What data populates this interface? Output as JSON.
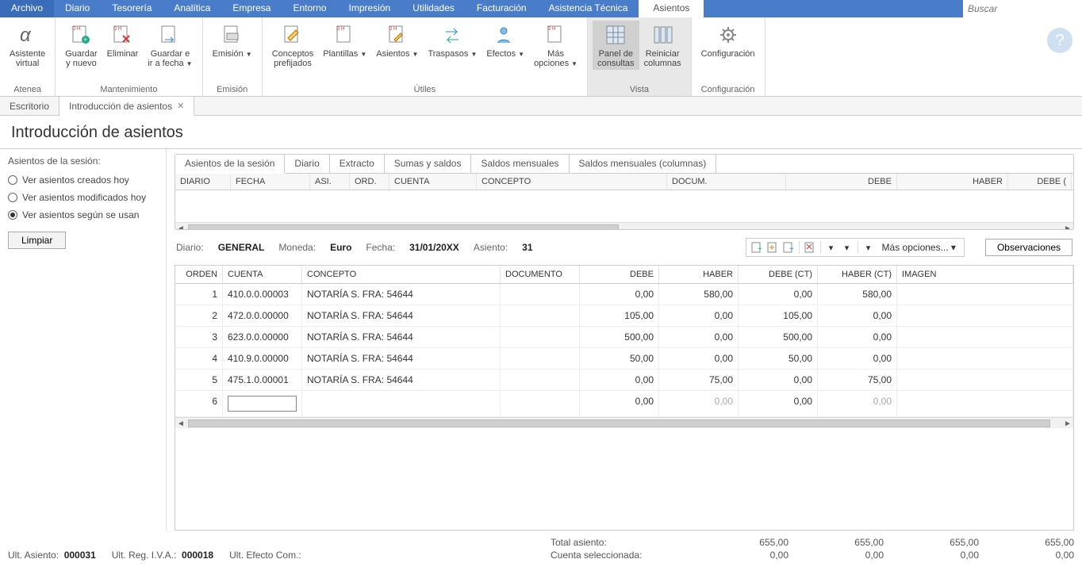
{
  "menu": {
    "items": [
      "Archivo",
      "Diario",
      "Tesorería",
      "Analítica",
      "Empresa",
      "Entorno",
      "Impresión",
      "Utilidades",
      "Facturación",
      "Asistencia Técnica"
    ],
    "active": "Asientos",
    "search_placeholder": "Buscar"
  },
  "ribbon": {
    "groups": [
      {
        "label": "Atenea",
        "buttons": [
          {
            "label": "Asistente\nvirtual",
            "icon": "alpha"
          }
        ]
      },
      {
        "label": "Mantenimiento",
        "buttons": [
          {
            "label": "Guardar\ny nuevo",
            "icon": "doc-plus"
          },
          {
            "label": "Eliminar",
            "icon": "doc-x"
          },
          {
            "label": "Guardar e\nir a fecha",
            "icon": "doc-arrow",
            "dd": true
          }
        ]
      },
      {
        "label": "Emisión",
        "buttons": [
          {
            "label": "Emisión",
            "icon": "doc-print",
            "dd": true
          }
        ]
      },
      {
        "label": "Útiles",
        "buttons": [
          {
            "label": "Conceptos\nprefijados",
            "icon": "doc-pen"
          },
          {
            "label": "Plantillas",
            "icon": "doc-tpl",
            "dd": true
          },
          {
            "label": "Asientos",
            "icon": "doc-pen2",
            "dd": true
          },
          {
            "label": "Traspasos",
            "icon": "swap",
            "dd": true
          },
          {
            "label": "Efectos",
            "icon": "person",
            "dd": true
          },
          {
            "label": "Más\nopciones",
            "icon": "doc-more",
            "dd": true
          }
        ]
      },
      {
        "label": "Vista",
        "highlight": true,
        "buttons": [
          {
            "label": "Panel de\nconsultas",
            "icon": "grid",
            "active": true
          },
          {
            "label": "Reiniciar\ncolumnas",
            "icon": "cols"
          }
        ]
      },
      {
        "label": "Configuración",
        "buttons": [
          {
            "label": "Configuración",
            "icon": "gear"
          }
        ]
      }
    ]
  },
  "doc_tabs": [
    {
      "label": "Escritorio",
      "active": false
    },
    {
      "label": "Introducción de asientos",
      "active": true,
      "closable": true
    }
  ],
  "page_title": "Introducción de asientos",
  "sidebar": {
    "title": "Asientos de la sesión:",
    "radios": [
      {
        "label": "Ver asientos creados hoy",
        "checked": false
      },
      {
        "label": "Ver asientos modificados hoy",
        "checked": false
      },
      {
        "label": "Ver asientos según se usan",
        "checked": true
      }
    ],
    "limpiar": "Limpiar"
  },
  "subtabs": [
    "Asientos de la sesión",
    "Diario",
    "Extracto",
    "Sumas y saldos",
    "Saldos mensuales",
    "Saldos mensuales (columnas)"
  ],
  "session_cols": [
    "DIARIO",
    "FECHA",
    "ASI.",
    "ORD.",
    "CUENTA",
    "CONCEPTO",
    "DOCUM.",
    "DEBE",
    "HABER",
    "DEBE ("
  ],
  "info": {
    "diario_lbl": "Diario:",
    "diario_val": "GENERAL",
    "moneda_lbl": "Moneda:",
    "moneda_val": "Euro",
    "fecha_lbl": "Fecha:",
    "fecha_val": "31/01/20XX",
    "asiento_lbl": "Asiento:",
    "asiento_val": "31",
    "mas_opciones": "Más opciones...",
    "observaciones": "Observaciones"
  },
  "entries": {
    "cols": [
      "ORDEN",
      "CUENTA",
      "CONCEPTO",
      "DOCUMENTO",
      "DEBE",
      "HABER",
      "DEBE (CT)",
      "HABER (CT)",
      "IMAGEN"
    ],
    "rows": [
      {
        "orden": "1",
        "cuenta": "410.0.0.00003",
        "concepto": "NOTARÍA S. FRA:  54644",
        "documento": "",
        "debe": "0,00",
        "haber": "580,00",
        "debect": "0,00",
        "haberct": "580,00"
      },
      {
        "orden": "2",
        "cuenta": "472.0.0.00000",
        "concepto": "NOTARÍA S. FRA:  54644",
        "documento": "",
        "debe": "105,00",
        "haber": "0,00",
        "debect": "105,00",
        "haberct": "0,00"
      },
      {
        "orden": "3",
        "cuenta": "623.0.0.00000",
        "concepto": "NOTARÍA S. FRA:  54644",
        "documento": "",
        "debe": "500,00",
        "haber": "0,00",
        "debect": "500,00",
        "haberct": "0,00"
      },
      {
        "orden": "4",
        "cuenta": "410.9.0.00000",
        "concepto": "NOTARÍA S. FRA:  54644",
        "documento": "",
        "debe": "50,00",
        "haber": "0,00",
        "debect": "50,00",
        "haberct": "0,00"
      },
      {
        "orden": "5",
        "cuenta": "475.1.0.00001",
        "concepto": "NOTARÍA S. FRA:  54644",
        "documento": "",
        "debe": "0,00",
        "haber": "75,00",
        "debect": "0,00",
        "haberct": "75,00"
      }
    ],
    "editing_row": {
      "orden": "6",
      "debe": "0,00",
      "haber": "0,00",
      "debect": "0,00",
      "haberct": "0,00"
    }
  },
  "footer": {
    "ult_asiento_lbl": "Ult. Asiento:",
    "ult_asiento_val": "000031",
    "ult_reg_iva_lbl": "Ult. Reg. I.V.A.:",
    "ult_reg_iva_val": "000018",
    "ult_efecto_lbl": "Ult. Efecto Com.:",
    "ult_efecto_val": "",
    "total_asiento_lbl": "Total asiento:",
    "cuenta_sel_lbl": "Cuenta seleccionada:",
    "totals": {
      "debe": "655,00",
      "haber": "655,00",
      "debect": "655,00",
      "haberct": "655,00"
    },
    "selected": {
      "debe": "0,00",
      "haber": "0,00",
      "debect": "0,00",
      "haberct": "0,00"
    }
  }
}
